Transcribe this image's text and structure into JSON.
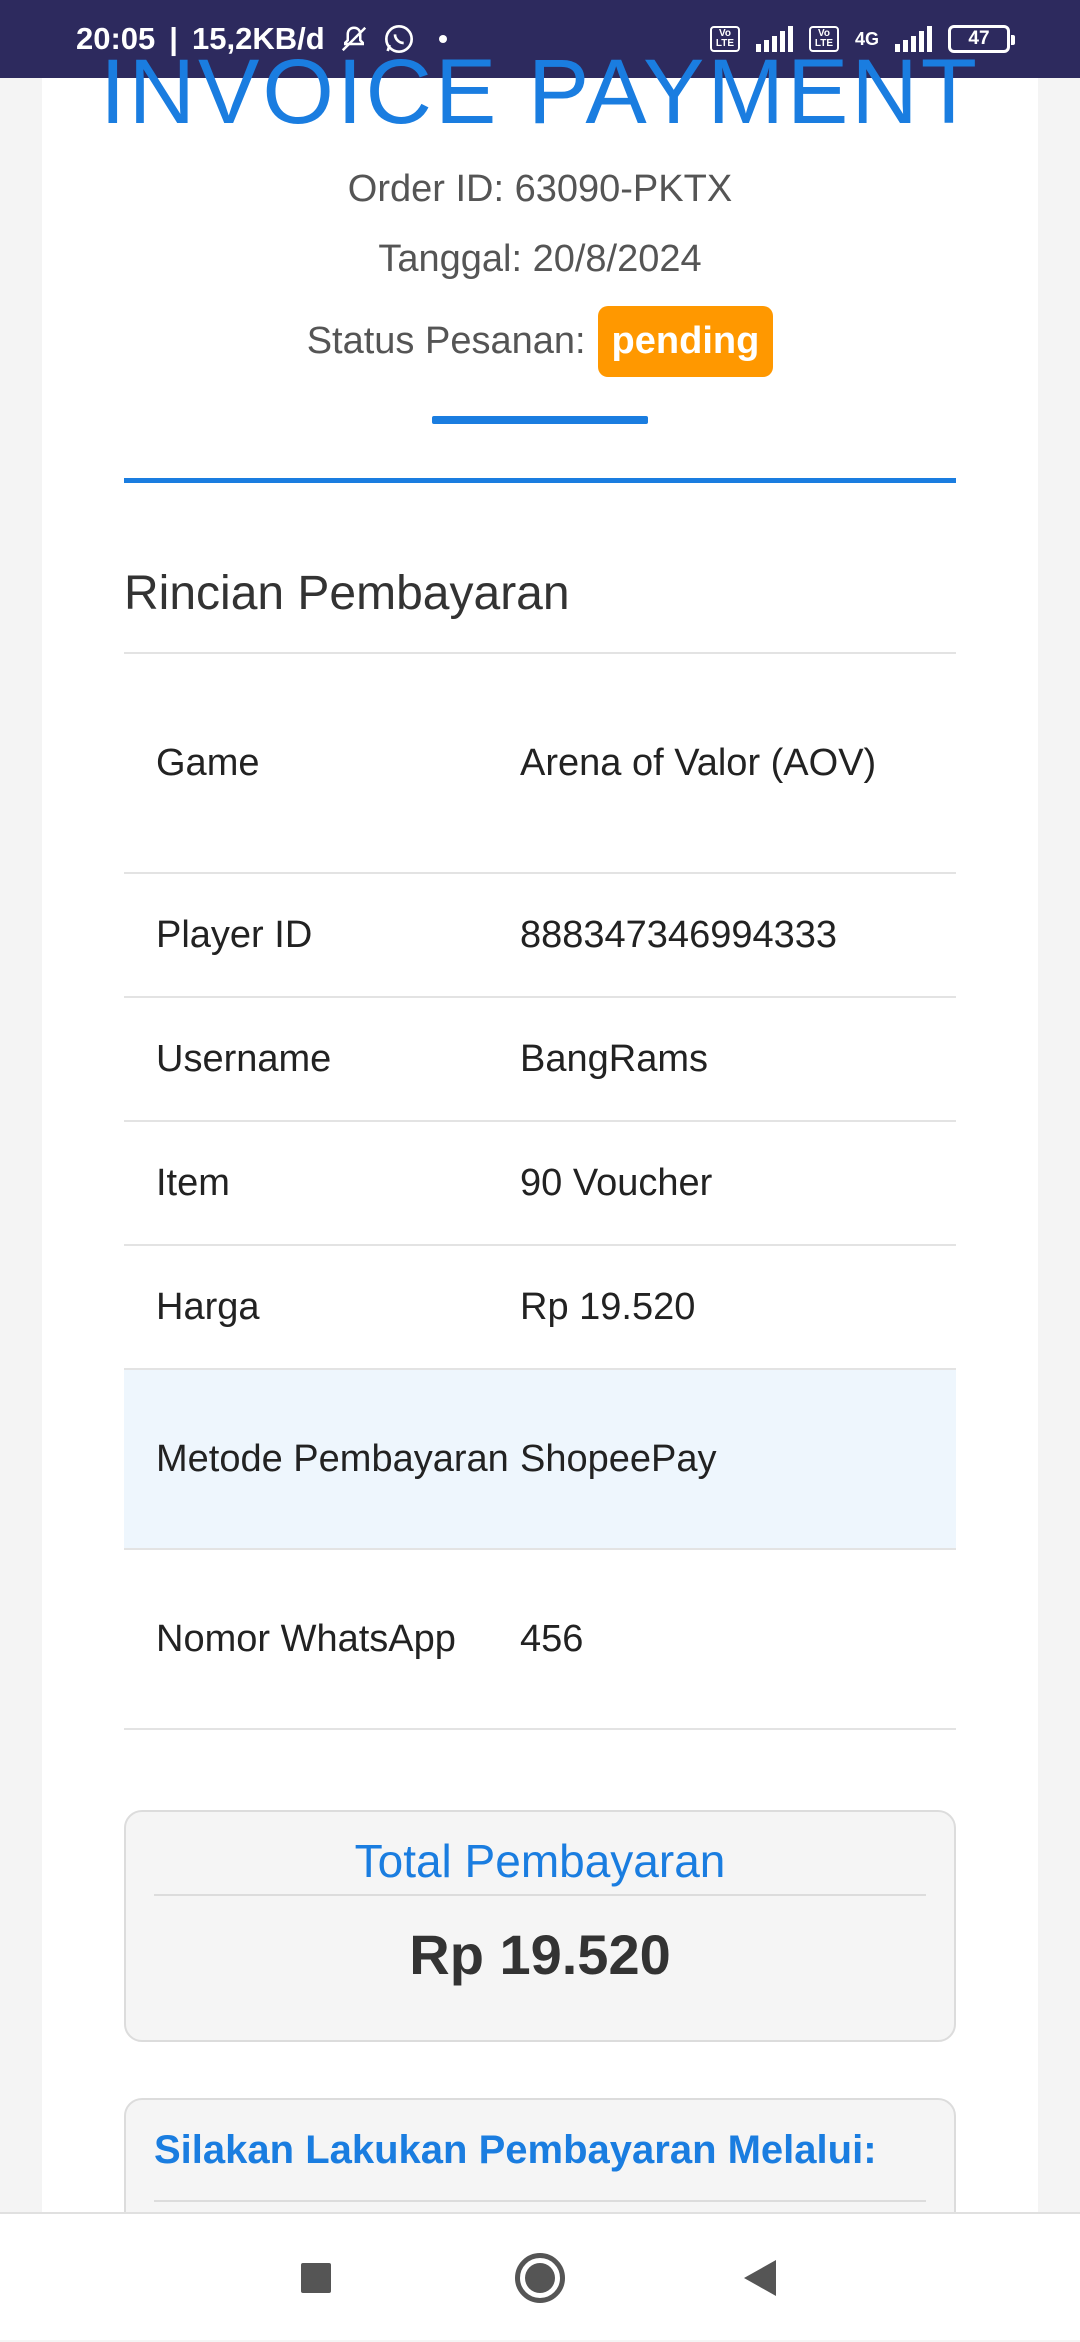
{
  "status_bar": {
    "time": "20:05",
    "net_speed": "15,2KB/d",
    "battery": "47",
    "net_type": "4G",
    "volte_label": "Vo LTE"
  },
  "invoice": {
    "title": "INVOICE PAYMENT",
    "order_id": "Order ID: 63090-PKTX",
    "date": "Tanggal: 20/8/2024",
    "status_label": "Status Pesanan:",
    "status_value": "pending"
  },
  "details": {
    "section_title": "Rincian Pembayaran",
    "rows": [
      {
        "label": "Game",
        "value": "Arena of Valor (AOV)"
      },
      {
        "label": "Player ID",
        "value": "888347346994333"
      },
      {
        "label": "Username",
        "value": "BangRams"
      },
      {
        "label": "Item",
        "value": "90 Voucher"
      },
      {
        "label": "Harga",
        "value": "Rp 19.520"
      },
      {
        "label": "Metode Pembayaran",
        "value": "ShopeePay"
      },
      {
        "label": "Nomor WhatsApp",
        "value": "456"
      }
    ]
  },
  "total": {
    "title": "Total Pembayaran",
    "amount": "Rp 19.520"
  },
  "payment_instructions": {
    "title": "Silakan Lakukan Pembayaran Melalui:"
  },
  "icons": {
    "mute": "notification-off-icon",
    "whatsapp": "whatsapp-icon",
    "signal": "signal-icon",
    "battery": "battery-icon",
    "recents": "recents-icon",
    "home": "home-icon",
    "back": "back-icon"
  },
  "colors": {
    "accent": "#1a7de0",
    "status_bar": "#2d2a5e",
    "pending_badge": "#ff9800",
    "highlight_row": "#eef6fd"
  }
}
